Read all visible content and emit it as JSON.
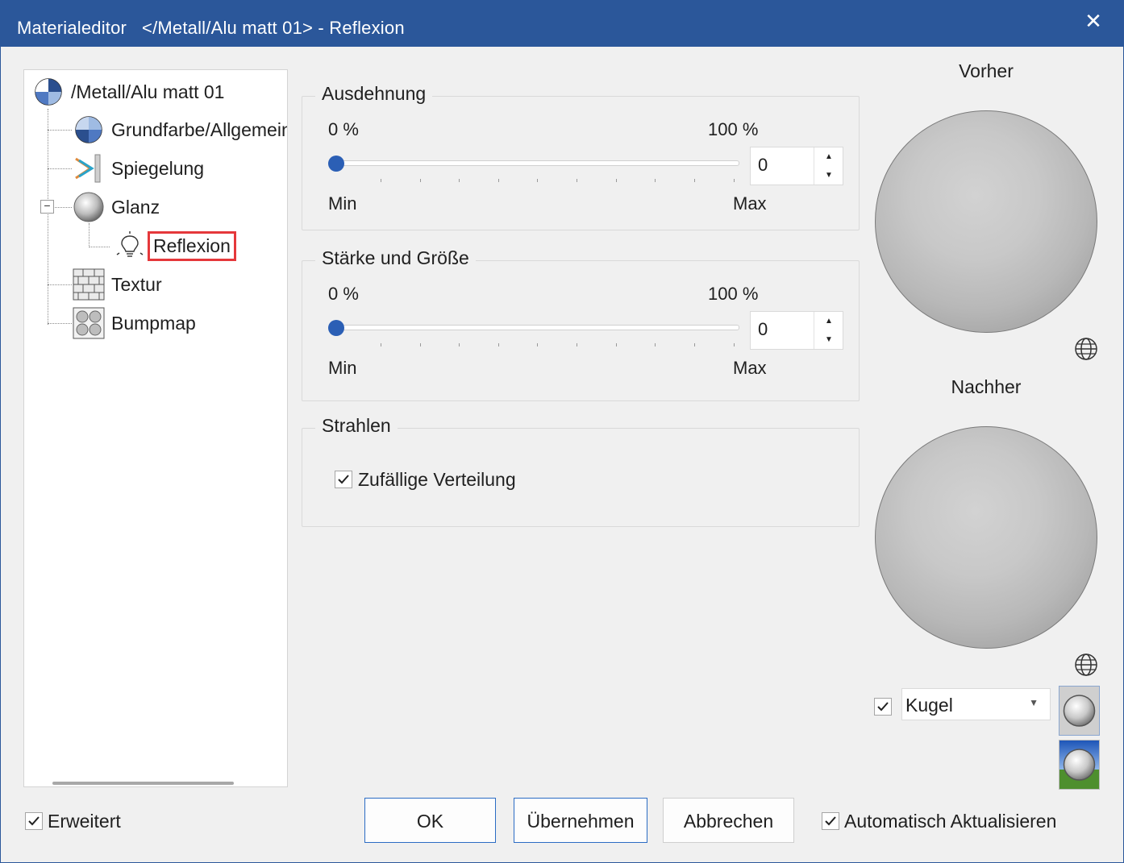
{
  "window": {
    "title": "Materialeditor   </Metall/Alu matt 01> - Reflexion",
    "close_symbol": "✕"
  },
  "tree": {
    "root": {
      "label": "/Metall/Alu matt 01",
      "icon": "material-pie-icon"
    },
    "items": [
      {
        "label": "Grundfarbe/Allgemein",
        "icon": "color-pie-icon"
      },
      {
        "label": "Spiegelung",
        "icon": "mirror-icon"
      },
      {
        "label": "Glanz",
        "icon": "gloss-sphere-icon",
        "expanded": true
      },
      {
        "label": "Reflexion",
        "icon": "lightbulb-icon",
        "selected": true
      },
      {
        "label": "Textur",
        "icon": "brick-icon"
      },
      {
        "label": "Bumpmap",
        "icon": "bumpmap-icon"
      }
    ],
    "expander_symbol": "−"
  },
  "ausdehnung": {
    "legend": "Ausdehnung",
    "label_left": "0 %",
    "label_right": "100 %",
    "min_label": "Min",
    "max_label": "Max",
    "value": "0",
    "slider_fraction": 0
  },
  "staerke": {
    "legend": "Stärke und Größe",
    "label_left": "0 %",
    "label_right": "100 %",
    "min_label": "Min",
    "max_label": "Max",
    "value": "0",
    "slider_fraction": 0
  },
  "strahlen": {
    "legend": "Strahlen",
    "random_label": "Zufällige Verteilung",
    "random_checked": true
  },
  "preview": {
    "before_label": "Vorher",
    "after_label": "Nachher",
    "shape_checked": true,
    "shape_value": "Kugel"
  },
  "footer": {
    "erweitert_label": "Erweitert",
    "erweitert_checked": true,
    "ok_label": "OK",
    "apply_label": "Übernehmen",
    "cancel_label": "Abbrechen",
    "auto_update_label": "Automatisch Aktualisieren",
    "auto_update_checked": true
  },
  "colors": {
    "titlebar": "#2b579a",
    "accent": "#2b5fb5",
    "selection_border": "#e5383b"
  }
}
